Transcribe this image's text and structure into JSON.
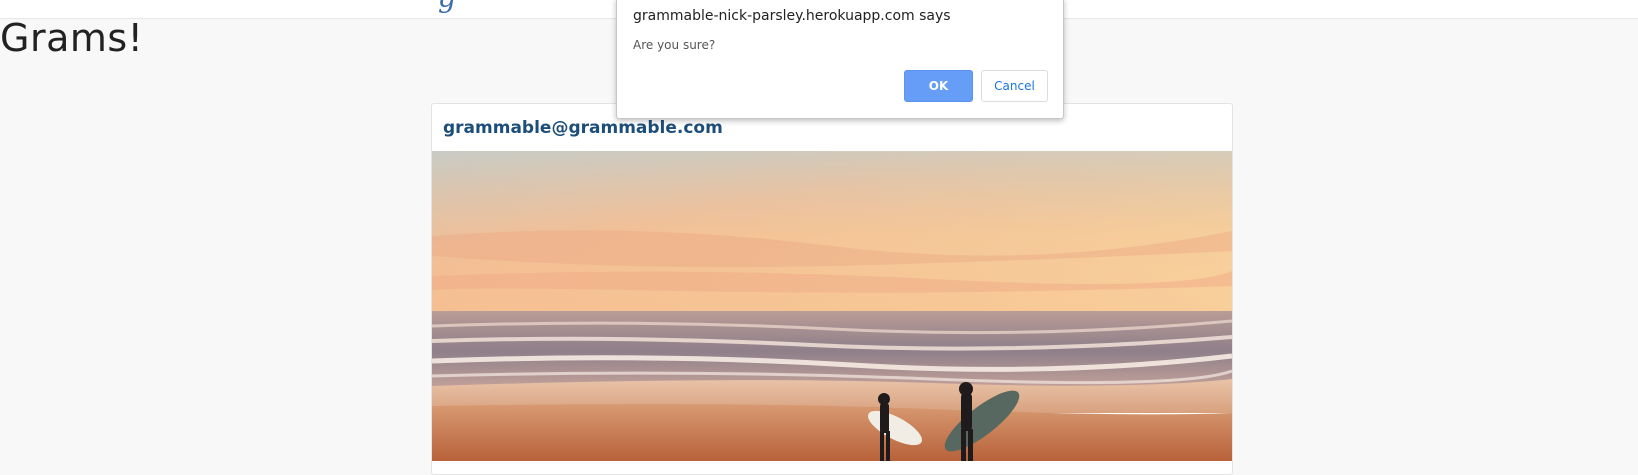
{
  "page": {
    "heading": "Grams!"
  },
  "post": {
    "user_email": "grammable@grammable.com",
    "photo_alt": "Two surfers walking on the beach at sunset"
  },
  "dialog": {
    "title": "grammable-nick-parsley.herokuapp.com says",
    "message": "Are you sure?",
    "ok_label": "OK",
    "cancel_label": "Cancel"
  },
  "colors": {
    "background": "#f8f8f8",
    "heading_text": "#222222",
    "user_link": "#1d4e7a",
    "ok_button": "#669df6",
    "cancel_text": "#1a73e8"
  }
}
